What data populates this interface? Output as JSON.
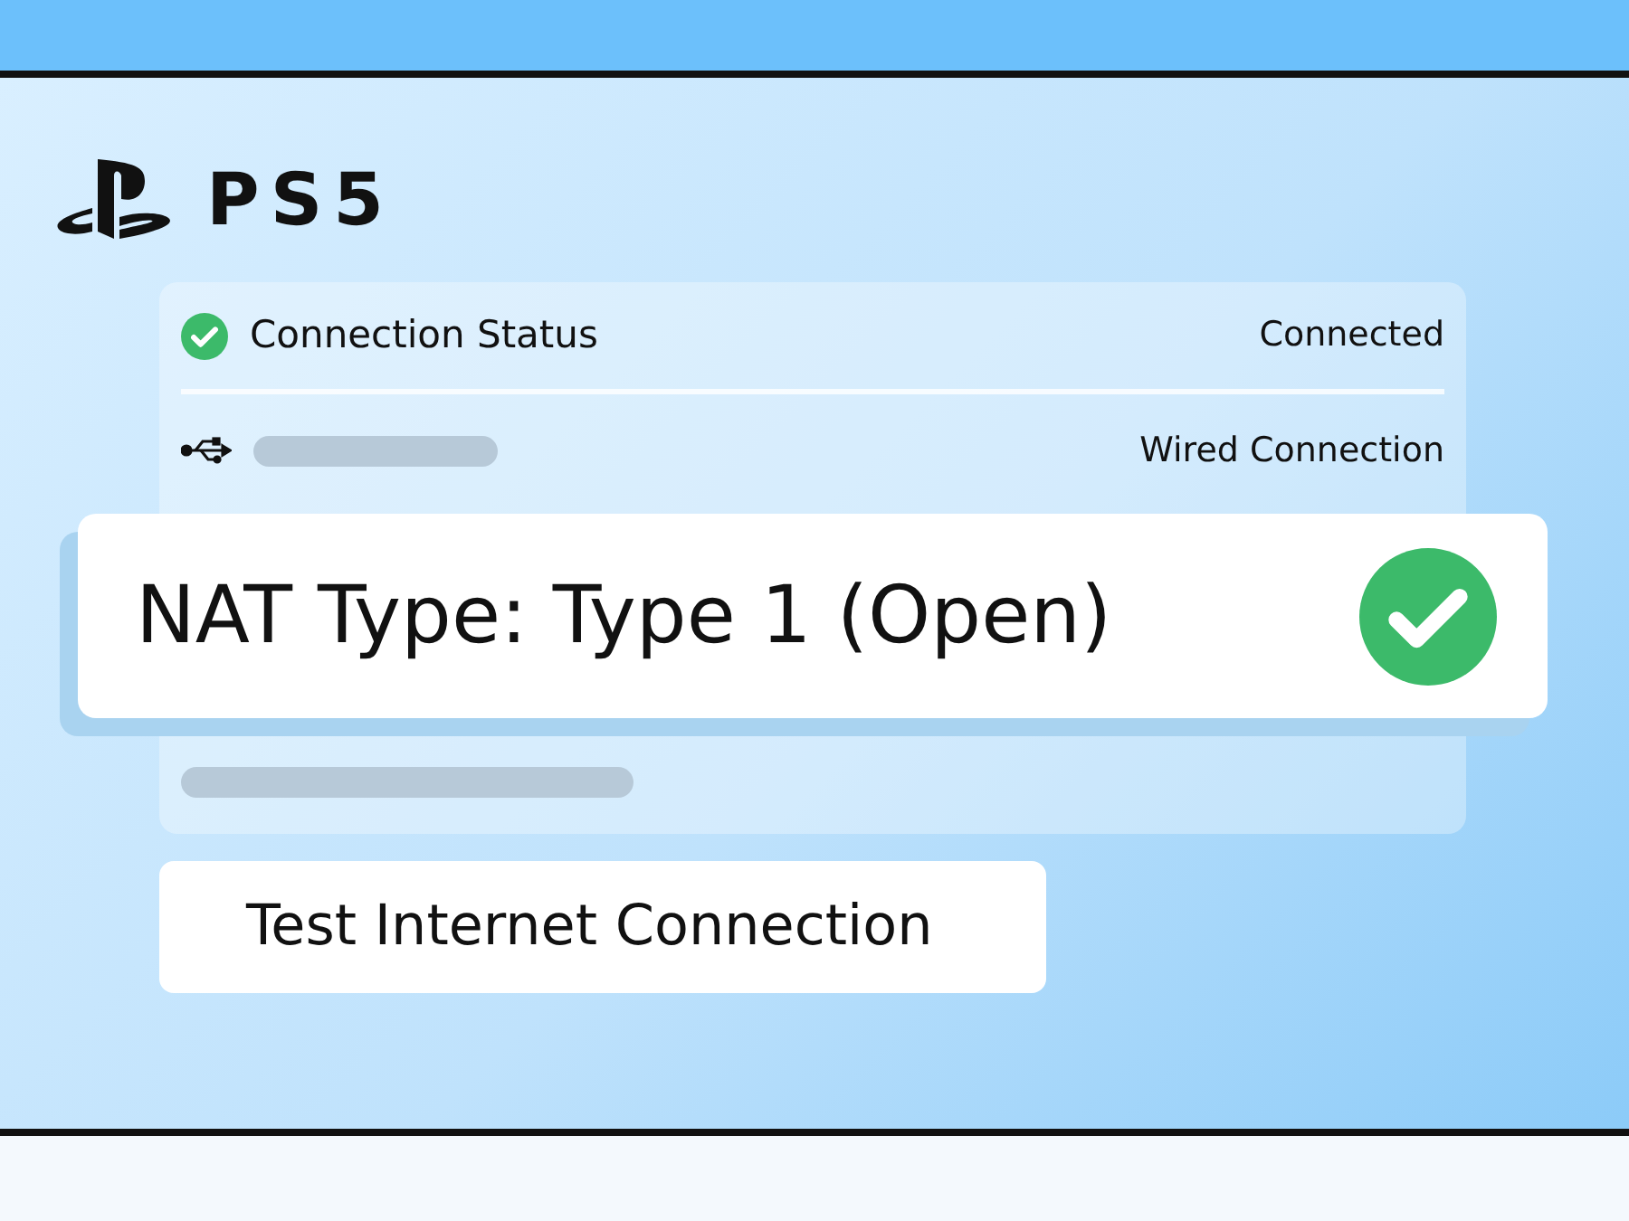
{
  "logo": {
    "text": "PS5"
  },
  "rows": [
    {
      "kind": "status",
      "label": "Connection Status",
      "value": "Connected"
    },
    {
      "kind": "usb",
      "value": "Wired Connection"
    }
  ],
  "nat": {
    "text": "NAT Type: Type 1 (Open)",
    "ok": true
  },
  "button": {
    "label": "Test Internet Connection"
  }
}
